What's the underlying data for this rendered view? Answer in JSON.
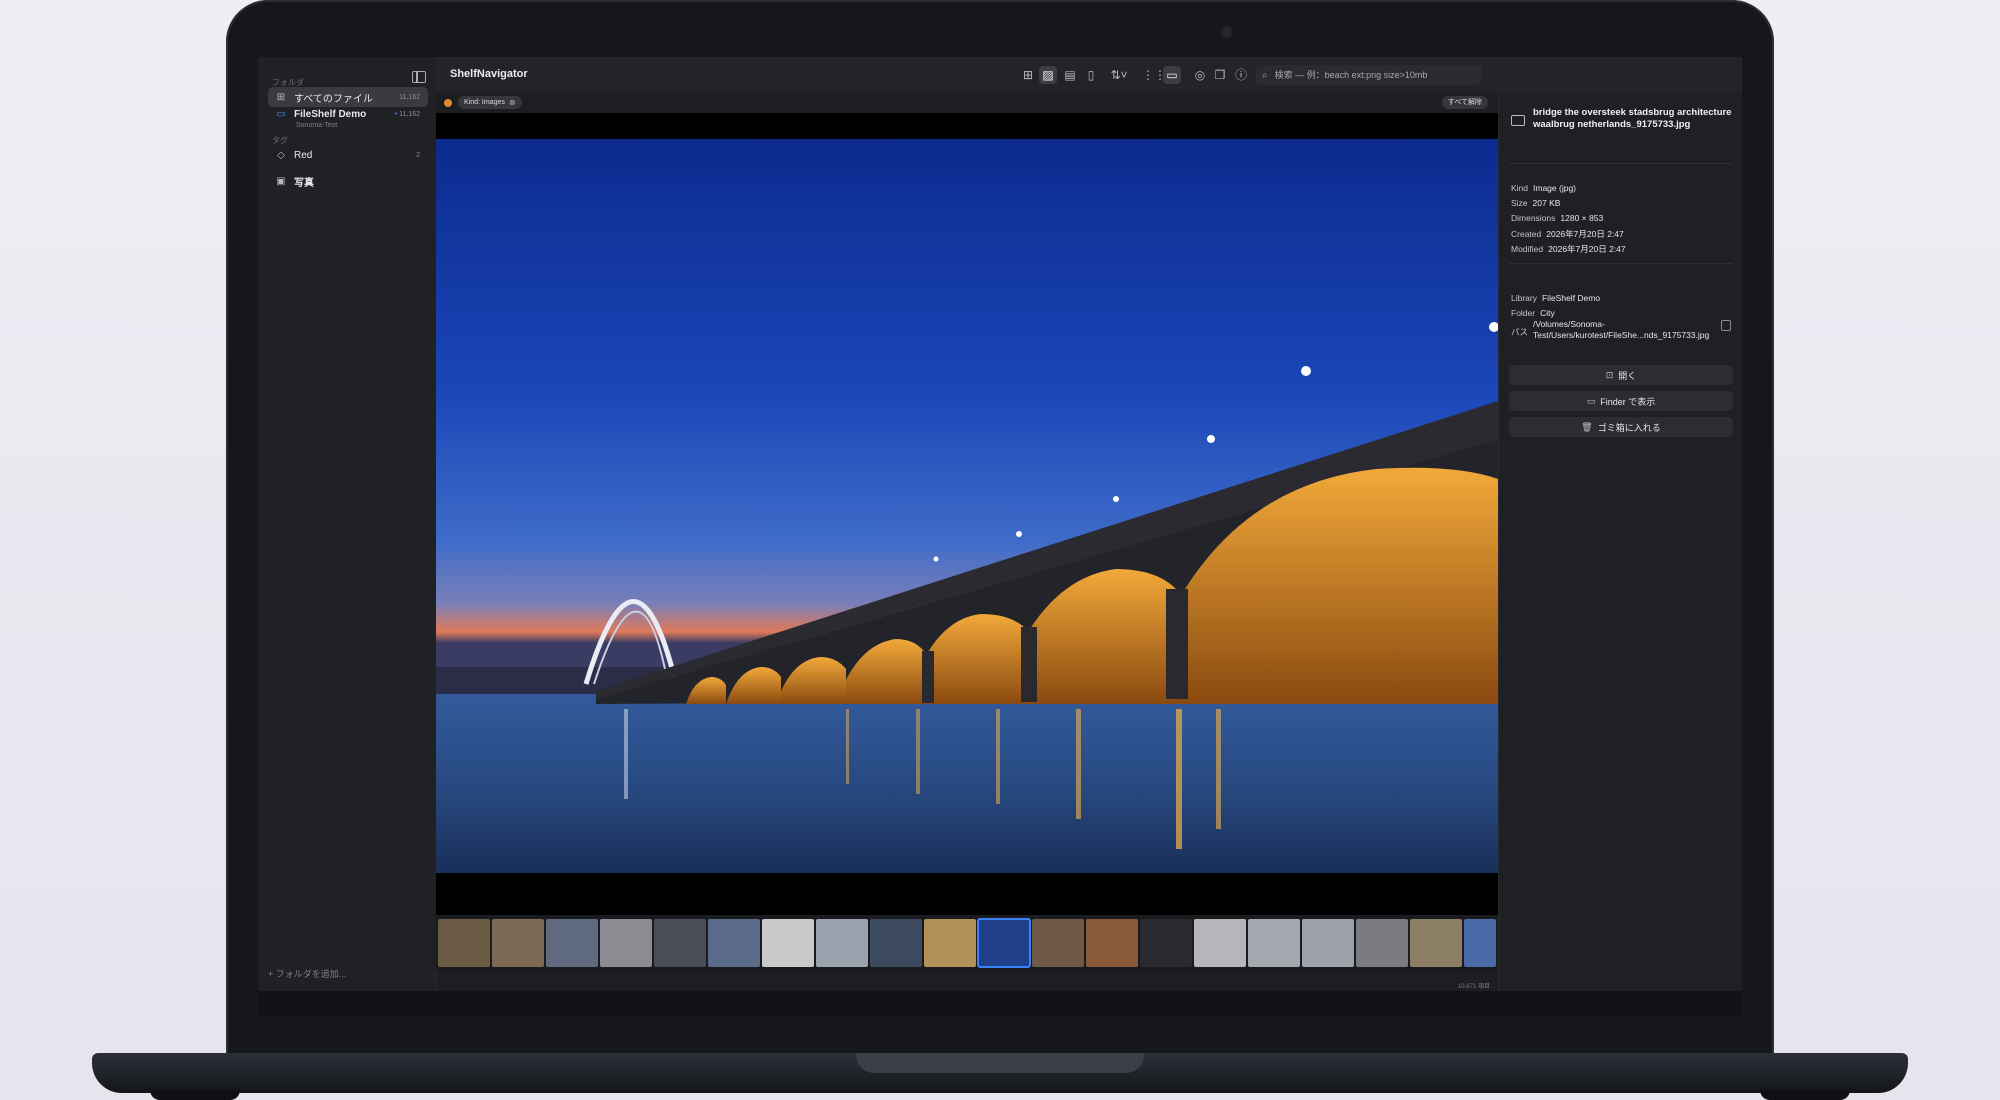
{
  "app": {
    "title": "ShelfNavigator"
  },
  "sidebar": {
    "folders_label": "フォルダ",
    "items": [
      {
        "label": "すべてのファイル",
        "count": "11,162"
      },
      {
        "label": "FileShelf Demo",
        "subtitle": "Sonoma-Test",
        "count": "11,162"
      }
    ],
    "tags_label": "タグ",
    "tags": [
      {
        "label": "Red",
        "count": "2"
      }
    ],
    "smart": [
      {
        "label": "写真"
      }
    ],
    "add_folder": "+  フォルダを追加..."
  },
  "toolbar": {
    "search_placeholder": "検索 — 例：beach ext:png size>10mb"
  },
  "filter": {
    "chip": "Kind: Images",
    "clear_all": "すべて解除"
  },
  "filmstrip": {
    "item_count": "10,871 項目"
  },
  "inspector": {
    "file_name": "bridge the oversteek stadsbrug architecture waalbrug netherlands_9175733.jpg",
    "kind": {
      "key": "Kind",
      "value": "Image (jpg)"
    },
    "size": {
      "key": "Size",
      "value": "207 KB"
    },
    "dimensions": {
      "key": "Dimensions",
      "value": "1280 × 853"
    },
    "created": {
      "key": "Created",
      "value": "2026年7月20日 2:47"
    },
    "modified": {
      "key": "Modified",
      "value": "2026年7月20日 2:47"
    },
    "library": {
      "key": "Library",
      "value": "FileShelf Demo"
    },
    "folder": {
      "key": "Folder",
      "value": "City"
    },
    "path": {
      "key": "パス",
      "value": "/Volumes/Sonoma-Test/Users/kurotest/FileShe...nds_9175733.jpg"
    },
    "actions": {
      "open": "開く",
      "finder": "Finder で表示",
      "trash": "ゴミ箱に入れる"
    }
  },
  "colors": {
    "accent": "#3b82f6",
    "filter_dot": "#e08a2b"
  }
}
